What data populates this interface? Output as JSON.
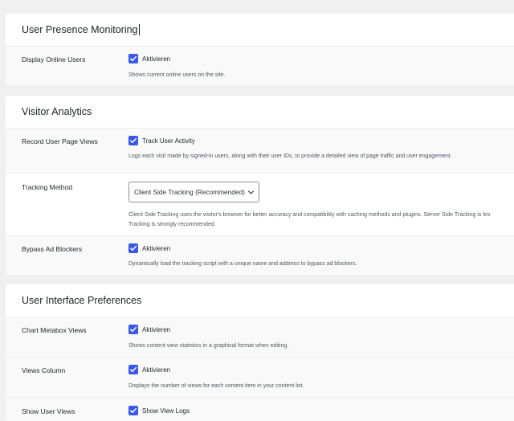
{
  "sections": [
    {
      "title": "User Presence Monitoring",
      "rows": [
        {
          "label": "Display Online Users",
          "checkbox_label": "Aktivieren",
          "checked": true,
          "description": "Shows current online users on the site."
        }
      ]
    },
    {
      "title": "Visitor Analytics",
      "rows": [
        {
          "label": "Record User Page Views",
          "checkbox_label": "Track User Activity",
          "checked": true,
          "description": "Logs each visit made by signed-in users, along with their user IDs, to provide a detailed view of page traffic and user engagement."
        },
        {
          "label": "Tracking Method",
          "select_value": "Client Side Tracking (Recommended)",
          "description_line1": "Client Side Tracking uses the visitor's browser for better accuracy and compatibility with caching methods and plugins. Server Side Tracking is les",
          "description_line2": "Tracking is strongly recommended."
        },
        {
          "label": "Bypass Ad Blockers",
          "checkbox_label": "Aktivieren",
          "checked": true,
          "description": "Dynamically load the tracking script with a unique name and address to bypass ad blockers."
        }
      ]
    },
    {
      "title": "User Interface Preferences",
      "rows": [
        {
          "label": "Chart Metabox Views",
          "checkbox_label": "Aktivieren",
          "checked": true,
          "description": "Shows content view statistics in a graphical format when editing."
        },
        {
          "label": "Views Column",
          "checkbox_label": "Aktivieren",
          "checked": true,
          "description": "Displays the number of views for each content item in your content list."
        },
        {
          "label": "Show User Views",
          "checkbox_label": "Show View Logs",
          "checked": true
        }
      ]
    }
  ],
  "colors": {
    "checkbox": "#3858e9",
    "background": "#f0f0f1",
    "panel": "#ffffff",
    "row": "#f9f9f9"
  }
}
